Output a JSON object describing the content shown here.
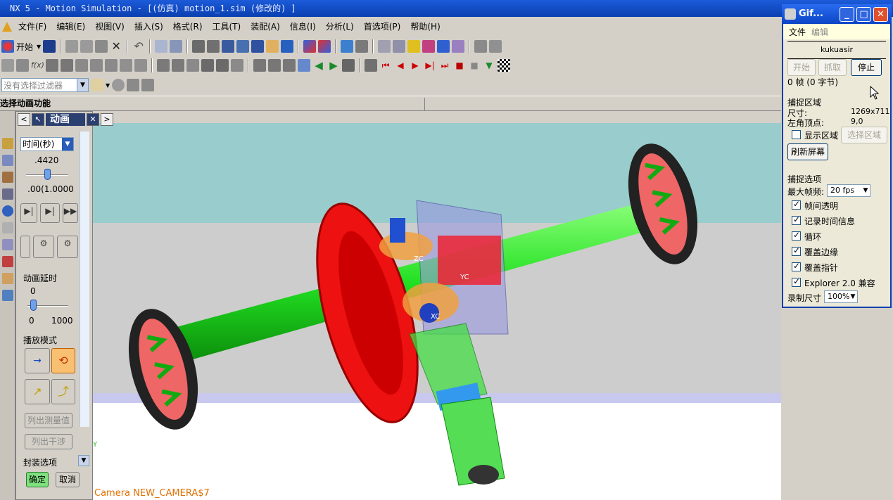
{
  "window": {
    "title": "NX 5 - Motion Simulation - [(仿真) motion_1.sim (修改的) ]"
  },
  "menubar": {
    "items": [
      "文件(F)",
      "编辑(E)",
      "视图(V)",
      "插入(S)",
      "格式(R)",
      "工具(T)",
      "装配(A)",
      "信息(I)",
      "分析(L)",
      "首选项(P)",
      "帮助(H)"
    ]
  },
  "toolbar": {
    "start_label": "开始",
    "filter_placeholder": "没有选择过滤器"
  },
  "cue": {
    "text": "选择动画功能"
  },
  "anim_panel": {
    "title": "动画",
    "time_mode": "时间(秒)",
    "time_value": ".4420",
    "time_range": ".00(1.0000",
    "delay_label": "动画延时",
    "delay_value": "0",
    "delay_min": "0",
    "delay_max": "1000",
    "play_mode_label": "播放模式",
    "list_measure": "列出测量值",
    "list_interference": "列出干涉",
    "package_options": "封装选项",
    "ok": "确定",
    "cancel": "取消"
  },
  "viewport": {
    "camera_label": "Camera NEW_CAMERA$7",
    "axis_zc": "ZC",
    "axis_yc": "YC",
    "axis_xc": "XC",
    "axis_y": "Y"
  },
  "gif_window": {
    "title": "Gif...",
    "menu_file": "文件",
    "menu_edit": "编辑",
    "user": "kukuasir",
    "btn_start": "开始",
    "btn_capture": "抓取",
    "btn_stop": "停止",
    "frames": "0 帧 (0 字节)",
    "capture_area_title": "捕捉区域",
    "size_label": "尺寸:",
    "size_value": "1269x711",
    "corner_label": "左角顶点:",
    "corner_value": "9,0",
    "show_area_label": "显示区域",
    "select_area_btn": "选择区域",
    "refresh_btn": "刷新屏幕",
    "capture_options_title": "捕捉选项",
    "max_fps_label": "最大帧频:",
    "max_fps_value": "20 fps",
    "options": [
      {
        "label": "帧间透明",
        "checked": true
      },
      {
        "label": "记录时间信息",
        "checked": true
      },
      {
        "label": "循环",
        "checked": true
      },
      {
        "label": "覆盖边缘",
        "checked": true
      },
      {
        "label": "覆盖指针",
        "checked": true
      },
      {
        "label": "Explorer 2.0 兼容",
        "checked": true
      }
    ],
    "record_size_label": "录制尺寸",
    "record_size_value": "100%"
  }
}
